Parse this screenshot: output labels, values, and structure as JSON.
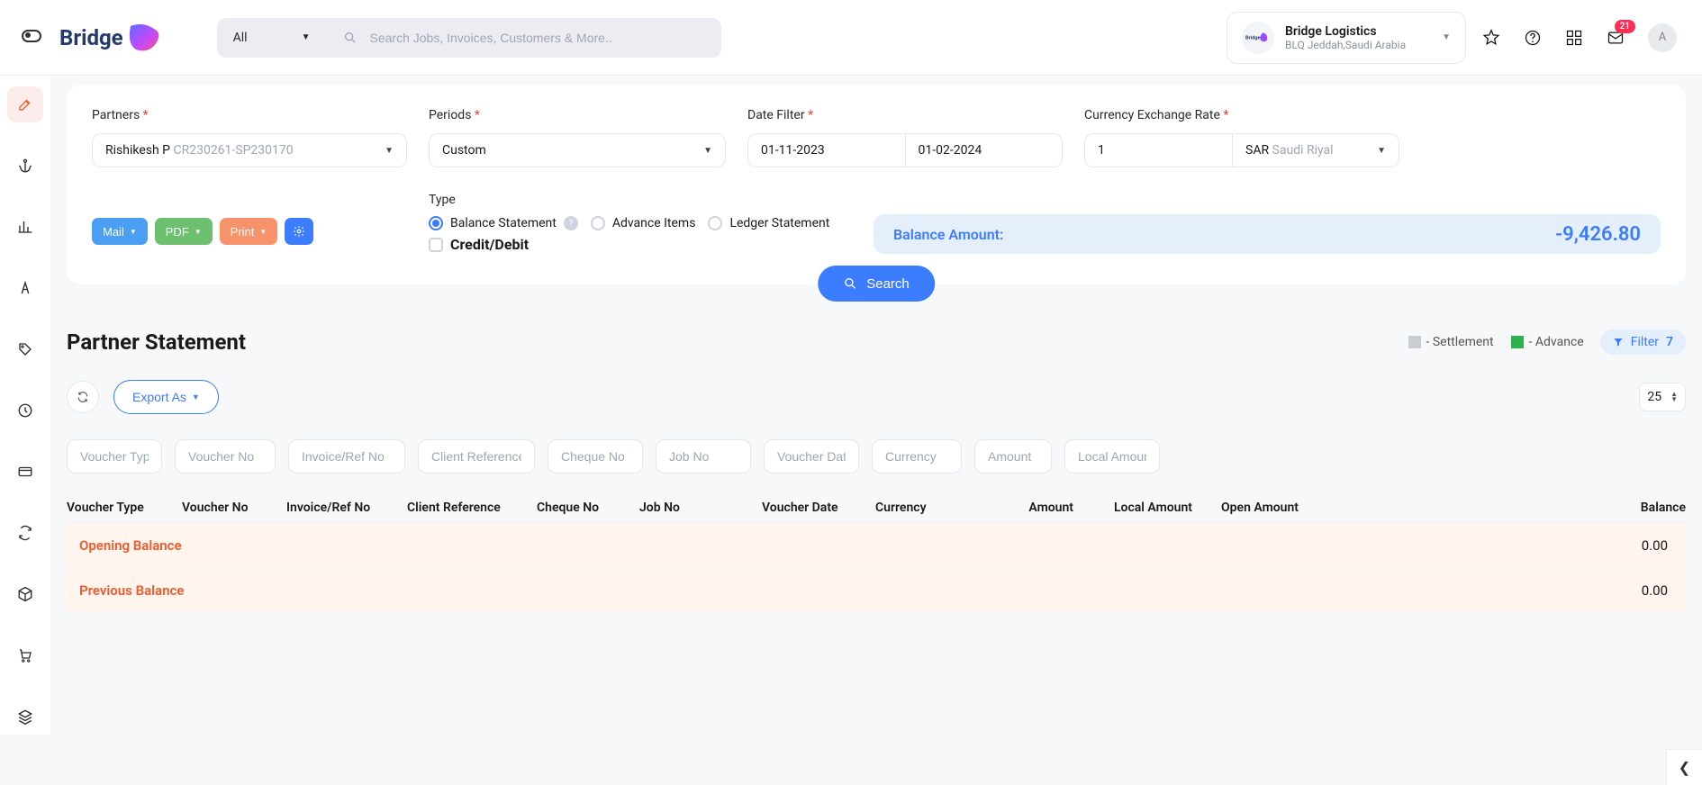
{
  "header": {
    "brand_name": "Bridge",
    "search": {
      "filter_label": "All",
      "placeholder": "Search Jobs, Invoices, Customers & More.."
    },
    "org": {
      "name": "Bridge Logistics",
      "sub": "BLQ Jeddah,Saudi Arabia"
    },
    "notification_count": "21",
    "avatar_initial": "A"
  },
  "filters": {
    "partners": {
      "label": "Partners",
      "value_main": "Rishikesh P",
      "value_sub": " CR230261-SP230170"
    },
    "periods": {
      "label": "Periods",
      "value": "Custom"
    },
    "date_filter": {
      "label": "Date Filter",
      "from": "01-11-2023",
      "to": "01-02-2024"
    },
    "rate": {
      "label": "Currency Exchange Rate",
      "value": "1",
      "currency_code": "SAR",
      "currency_name": " Saudi Riyal"
    }
  },
  "actions": {
    "mail": "Mail",
    "pdf": "PDF",
    "print": "Print"
  },
  "type": {
    "label": "Type",
    "opt_balance": "Balance Statement",
    "opt_advance": "Advance Items",
    "opt_ledger": "Ledger Statement",
    "opt_cd": "Credit/Debit"
  },
  "balance": {
    "label": "Balance Amount:",
    "value": "-9,426.80"
  },
  "search_btn": "Search",
  "statement": {
    "title": "Partner Statement",
    "legend_settlement": "- Settlement",
    "legend_advance": "- Advance",
    "filter_label": "Filter",
    "filter_count": "7",
    "export_label": "Export As",
    "page_size": "25",
    "col_filters_ph": {
      "voucher_type": "Voucher Type",
      "voucher_no": "Voucher No",
      "invoice_ref": "Invoice/Ref No",
      "client_ref": "Client Reference",
      "cheque_no": "Cheque No",
      "job_no": "Job No",
      "voucher_date": "Voucher Date",
      "currency": "Currency",
      "amount": "Amount",
      "local_amount": "Local Amount"
    },
    "columns": {
      "voucher_type": "Voucher Type",
      "voucher_no": "Voucher No",
      "invoice_ref": "Invoice/Ref No",
      "client_ref": "Client Reference",
      "cheque_no": "Cheque No",
      "job_no": "Job No",
      "voucher_date": "Voucher Date",
      "currency": "Currency",
      "amount": "Amount",
      "local_amount": "Local Amount",
      "open_amount": "Open Amount",
      "balance": "Balance"
    },
    "rows": {
      "opening_balance": {
        "label": "Opening Balance",
        "value": "0.00"
      },
      "previous_balance": {
        "label": "Previous Balance",
        "value": "0.00"
      }
    }
  }
}
